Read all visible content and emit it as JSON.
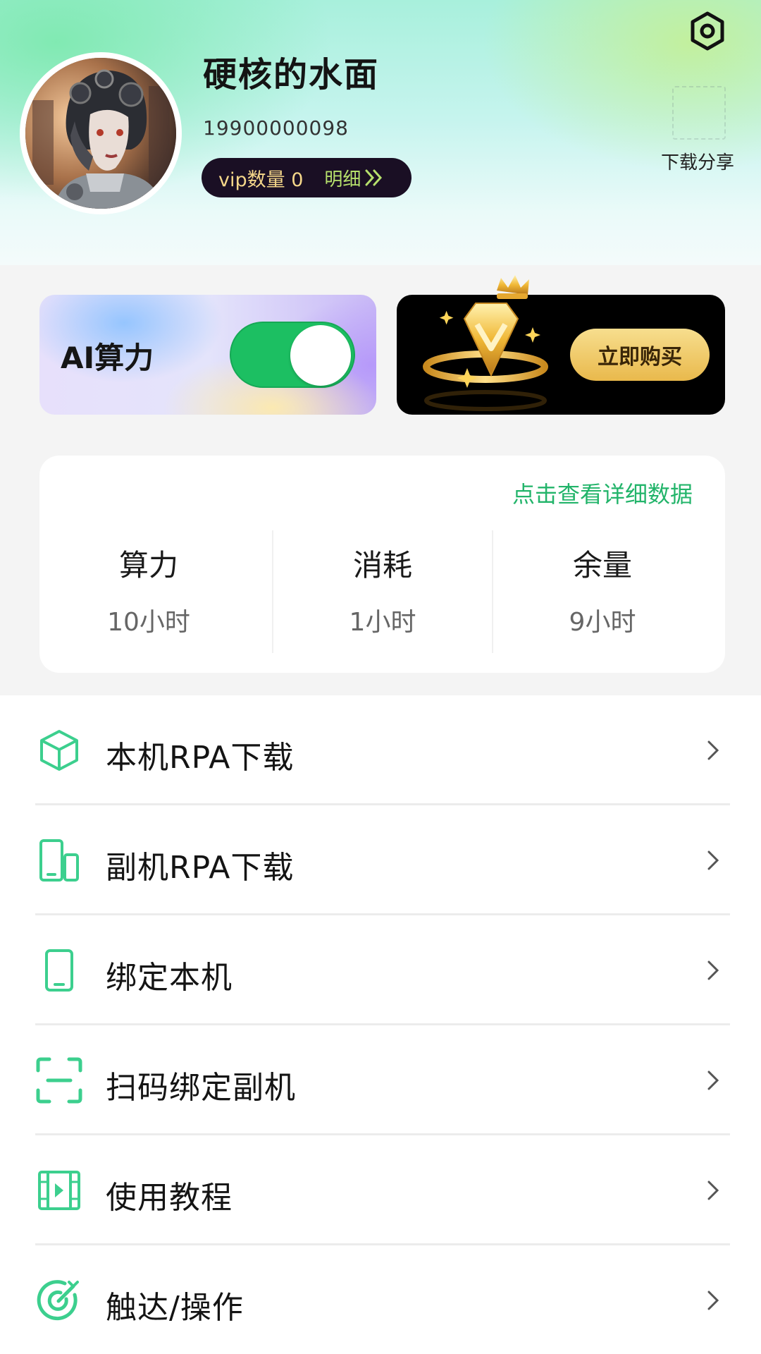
{
  "header": {
    "username": "硬核的水面",
    "phone": "19900000098",
    "vip_count_text": "vip数量 0",
    "vip_detail_label": "明细",
    "share_label": "下载分享",
    "settings_icon": "gear-hexagon-icon"
  },
  "ai_card": {
    "label": "AI算力",
    "toggle_on": true,
    "accent_color": "#1cbf62"
  },
  "vip_banner": {
    "buy_label": "立即购买",
    "graphic": "crown-diamond-icon"
  },
  "stats": {
    "detail_link": "点击查看详细数据",
    "items": [
      {
        "label": "算力",
        "value": "10小时"
      },
      {
        "label": "消耗",
        "value": "1小时"
      },
      {
        "label": "余量",
        "value": "9小时"
      }
    ]
  },
  "menu": {
    "items": [
      {
        "label": "本机RPA下载",
        "icon": "cube-icon"
      },
      {
        "label": "副机RPA下载",
        "icon": "devices-icon"
      },
      {
        "label": "绑定本机",
        "icon": "phone-icon"
      },
      {
        "label": "扫码绑定副机",
        "icon": "scan-icon"
      },
      {
        "label": "使用教程",
        "icon": "video-icon"
      },
      {
        "label": "触达/操作",
        "icon": "target-icon"
      }
    ]
  },
  "theme": {
    "green": "#22b46a",
    "icon_green": "#3ccf8e"
  }
}
